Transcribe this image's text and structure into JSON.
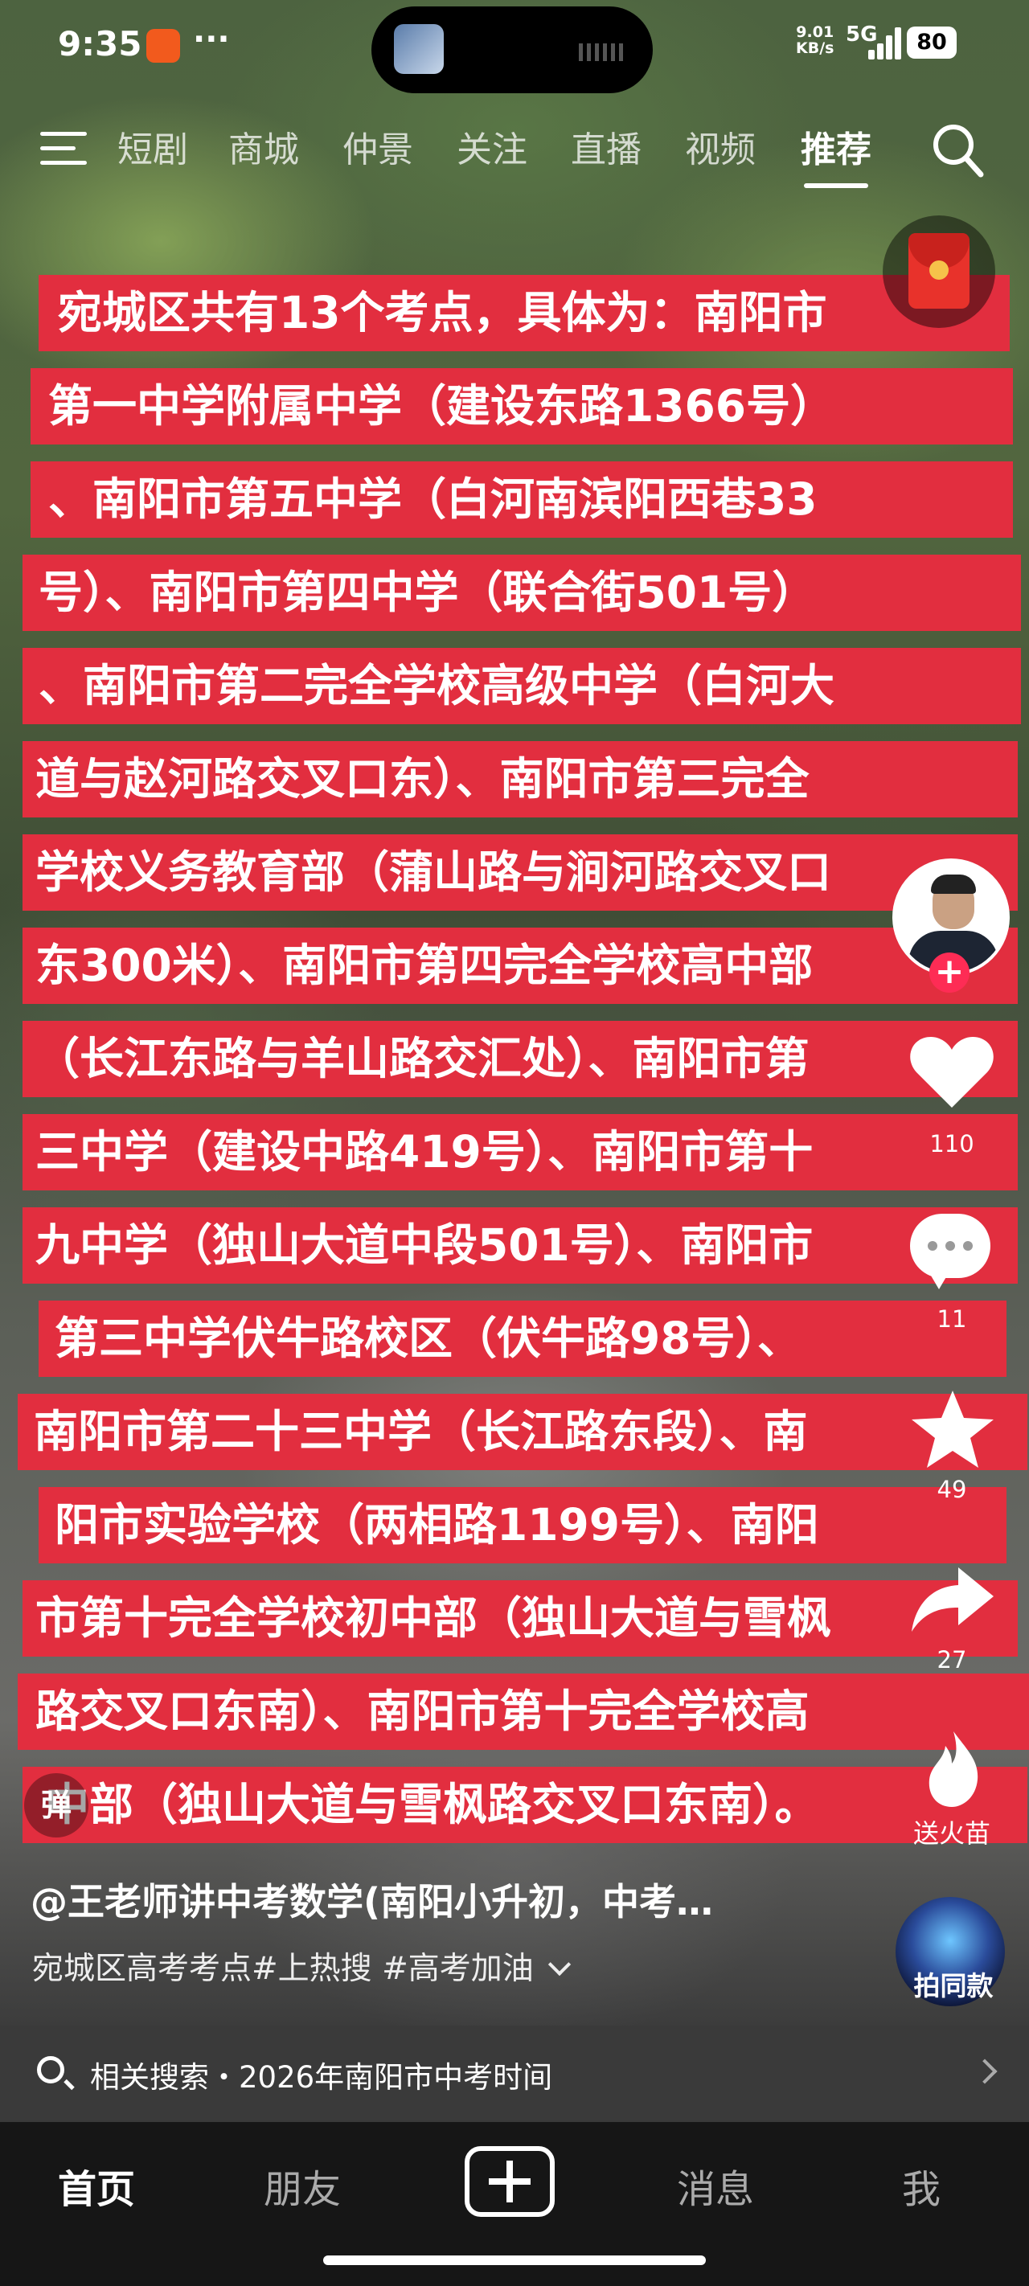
{
  "status_bar": {
    "time": "9:35",
    "more": "···",
    "net_speed": "9.01",
    "net_unit": "KB/s",
    "network": "5G",
    "battery": "80"
  },
  "top_nav": {
    "items": [
      "短剧",
      "商城",
      "仲景",
      "关注",
      "直播",
      "视频",
      "推荐"
    ],
    "active": "推荐"
  },
  "captions": [
    "宛城区共有13个考点，具体为：南阳市",
    "第一中学附属中学（建设东路1366号）",
    "、南阳市第五中学（白河南滨阳西巷33",
    "号）、南阳市第四中学（联合街501号）",
    "、南阳市第二完全学校高级中学（白河大",
    "道与赵河路交叉口东）、南阳市第三完全",
    "学校义务教育部（蒲山路与涧河路交叉口",
    "东300米）、南阳市第四完全学校高中部",
    "（长江东路与羊山路交汇处）、南阳市第",
    "三中学（建设中路419号）、南阳市第十",
    "九中学（独山大道中段501号）、南阳市",
    "第三中学伏牛路校区（伏牛路98号）、",
    "南阳市第二十三中学（长江路东段）、南",
    "阳市实验学校（两相路1199号）、南阳",
    "市第十完全学校初中部（独山大道与雪枫",
    "路交叉口东南）、南阳市第十完全学校高",
    "中部（独山大道与雪枫路交叉口东南）。"
  ],
  "rail": {
    "like_count": "110",
    "comment_count": "11",
    "favorite_count": "49",
    "share_count": "27",
    "send_fire": "送火苗",
    "same_clip": "拍同款",
    "danmu": "弹"
  },
  "video_info": {
    "author": "@王老师讲中考数学(南阳小升初，中考…",
    "description": "宛城区高考考点#上热搜 #高考加油"
  },
  "related_search": {
    "text": "相关搜索・2026年南阳市中考时间"
  },
  "bottom_tabs": {
    "home": "首页",
    "friends": "朋友",
    "messages": "消息",
    "me": "我"
  }
}
